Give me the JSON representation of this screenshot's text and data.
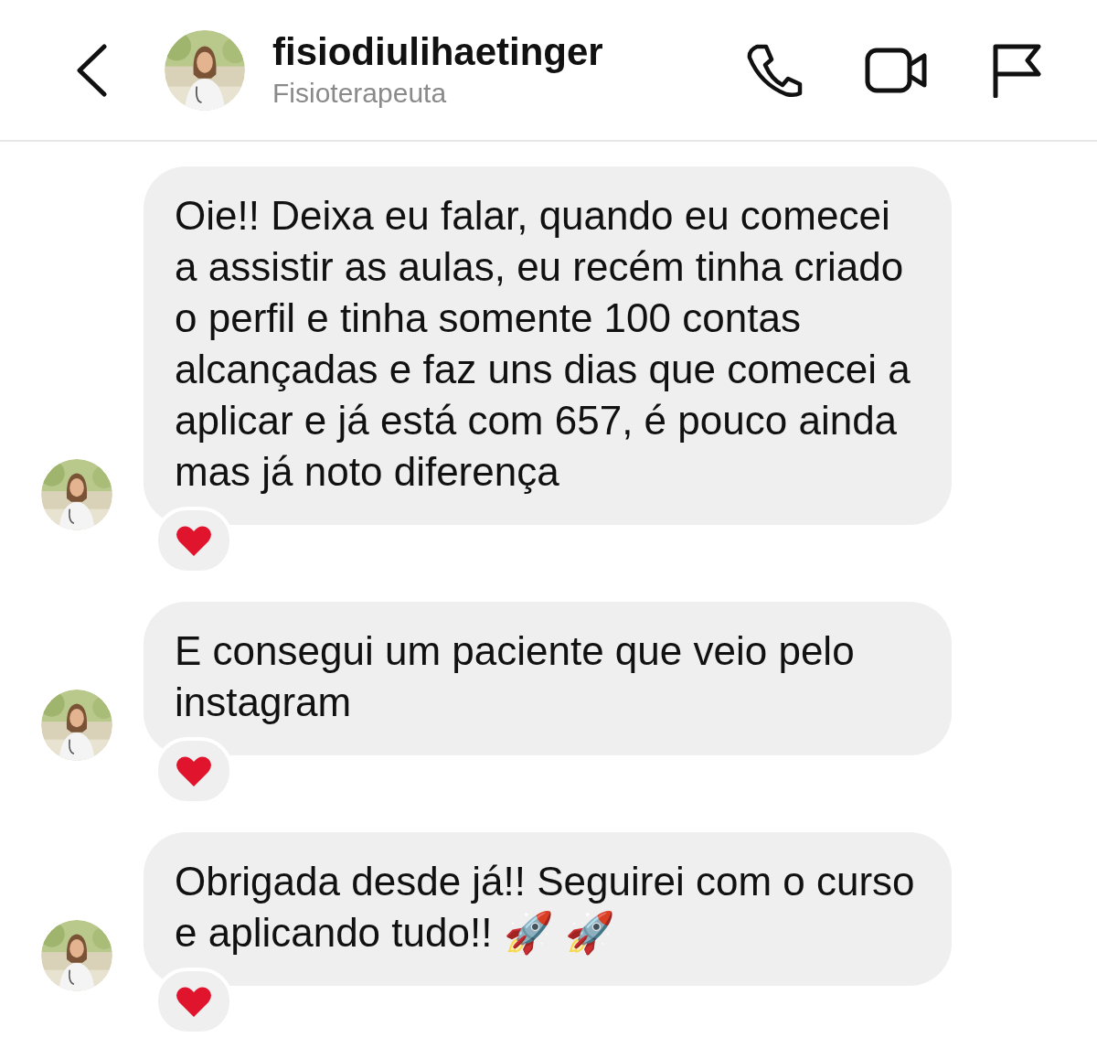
{
  "header": {
    "username": "fisiodiulihaetinger",
    "subtitle": "Fisioterapeuta"
  },
  "messages": [
    {
      "text": "Oie!! Deixa eu falar, quando eu comecei a assistir as aulas, eu recém tinha criado o perfil e tinha somente 100 contas alcançadas e faz uns dias que comecei a aplicar e já está com 657, é pouco ainda mas já noto diferença",
      "reacted": true
    },
    {
      "text": "E consegui um paciente que veio pelo instagram",
      "reacted": true
    },
    {
      "text": "Obrigada desde já!! Seguirei com o curso e aplicando tudo!! 🚀 🚀",
      "reacted": true
    }
  ]
}
